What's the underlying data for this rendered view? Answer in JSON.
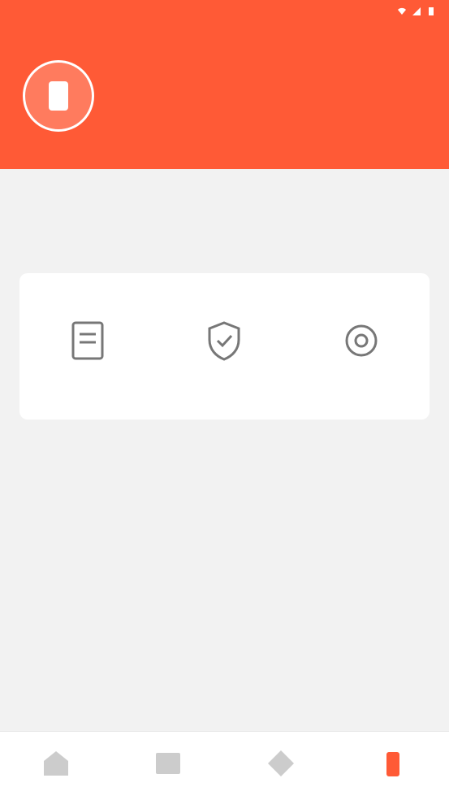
{
  "theme": {
    "accent": "#ff5a36"
  },
  "status_bar": {
    "time": ""
  },
  "header": {
    "app_title": ""
  },
  "menu": {
    "items": [
      {
        "label": "",
        "icon": "document-icon"
      },
      {
        "label": "",
        "icon": "shield-icon"
      },
      {
        "label": "",
        "icon": "gear-icon"
      }
    ]
  },
  "tab_bar": {
    "items": [
      {
        "label": "",
        "icon": "home-icon"
      },
      {
        "label": "",
        "icon": "image-icon"
      },
      {
        "label": "",
        "icon": "star-icon"
      },
      {
        "label": "",
        "icon": "battery-icon",
        "active": true
      }
    ]
  }
}
